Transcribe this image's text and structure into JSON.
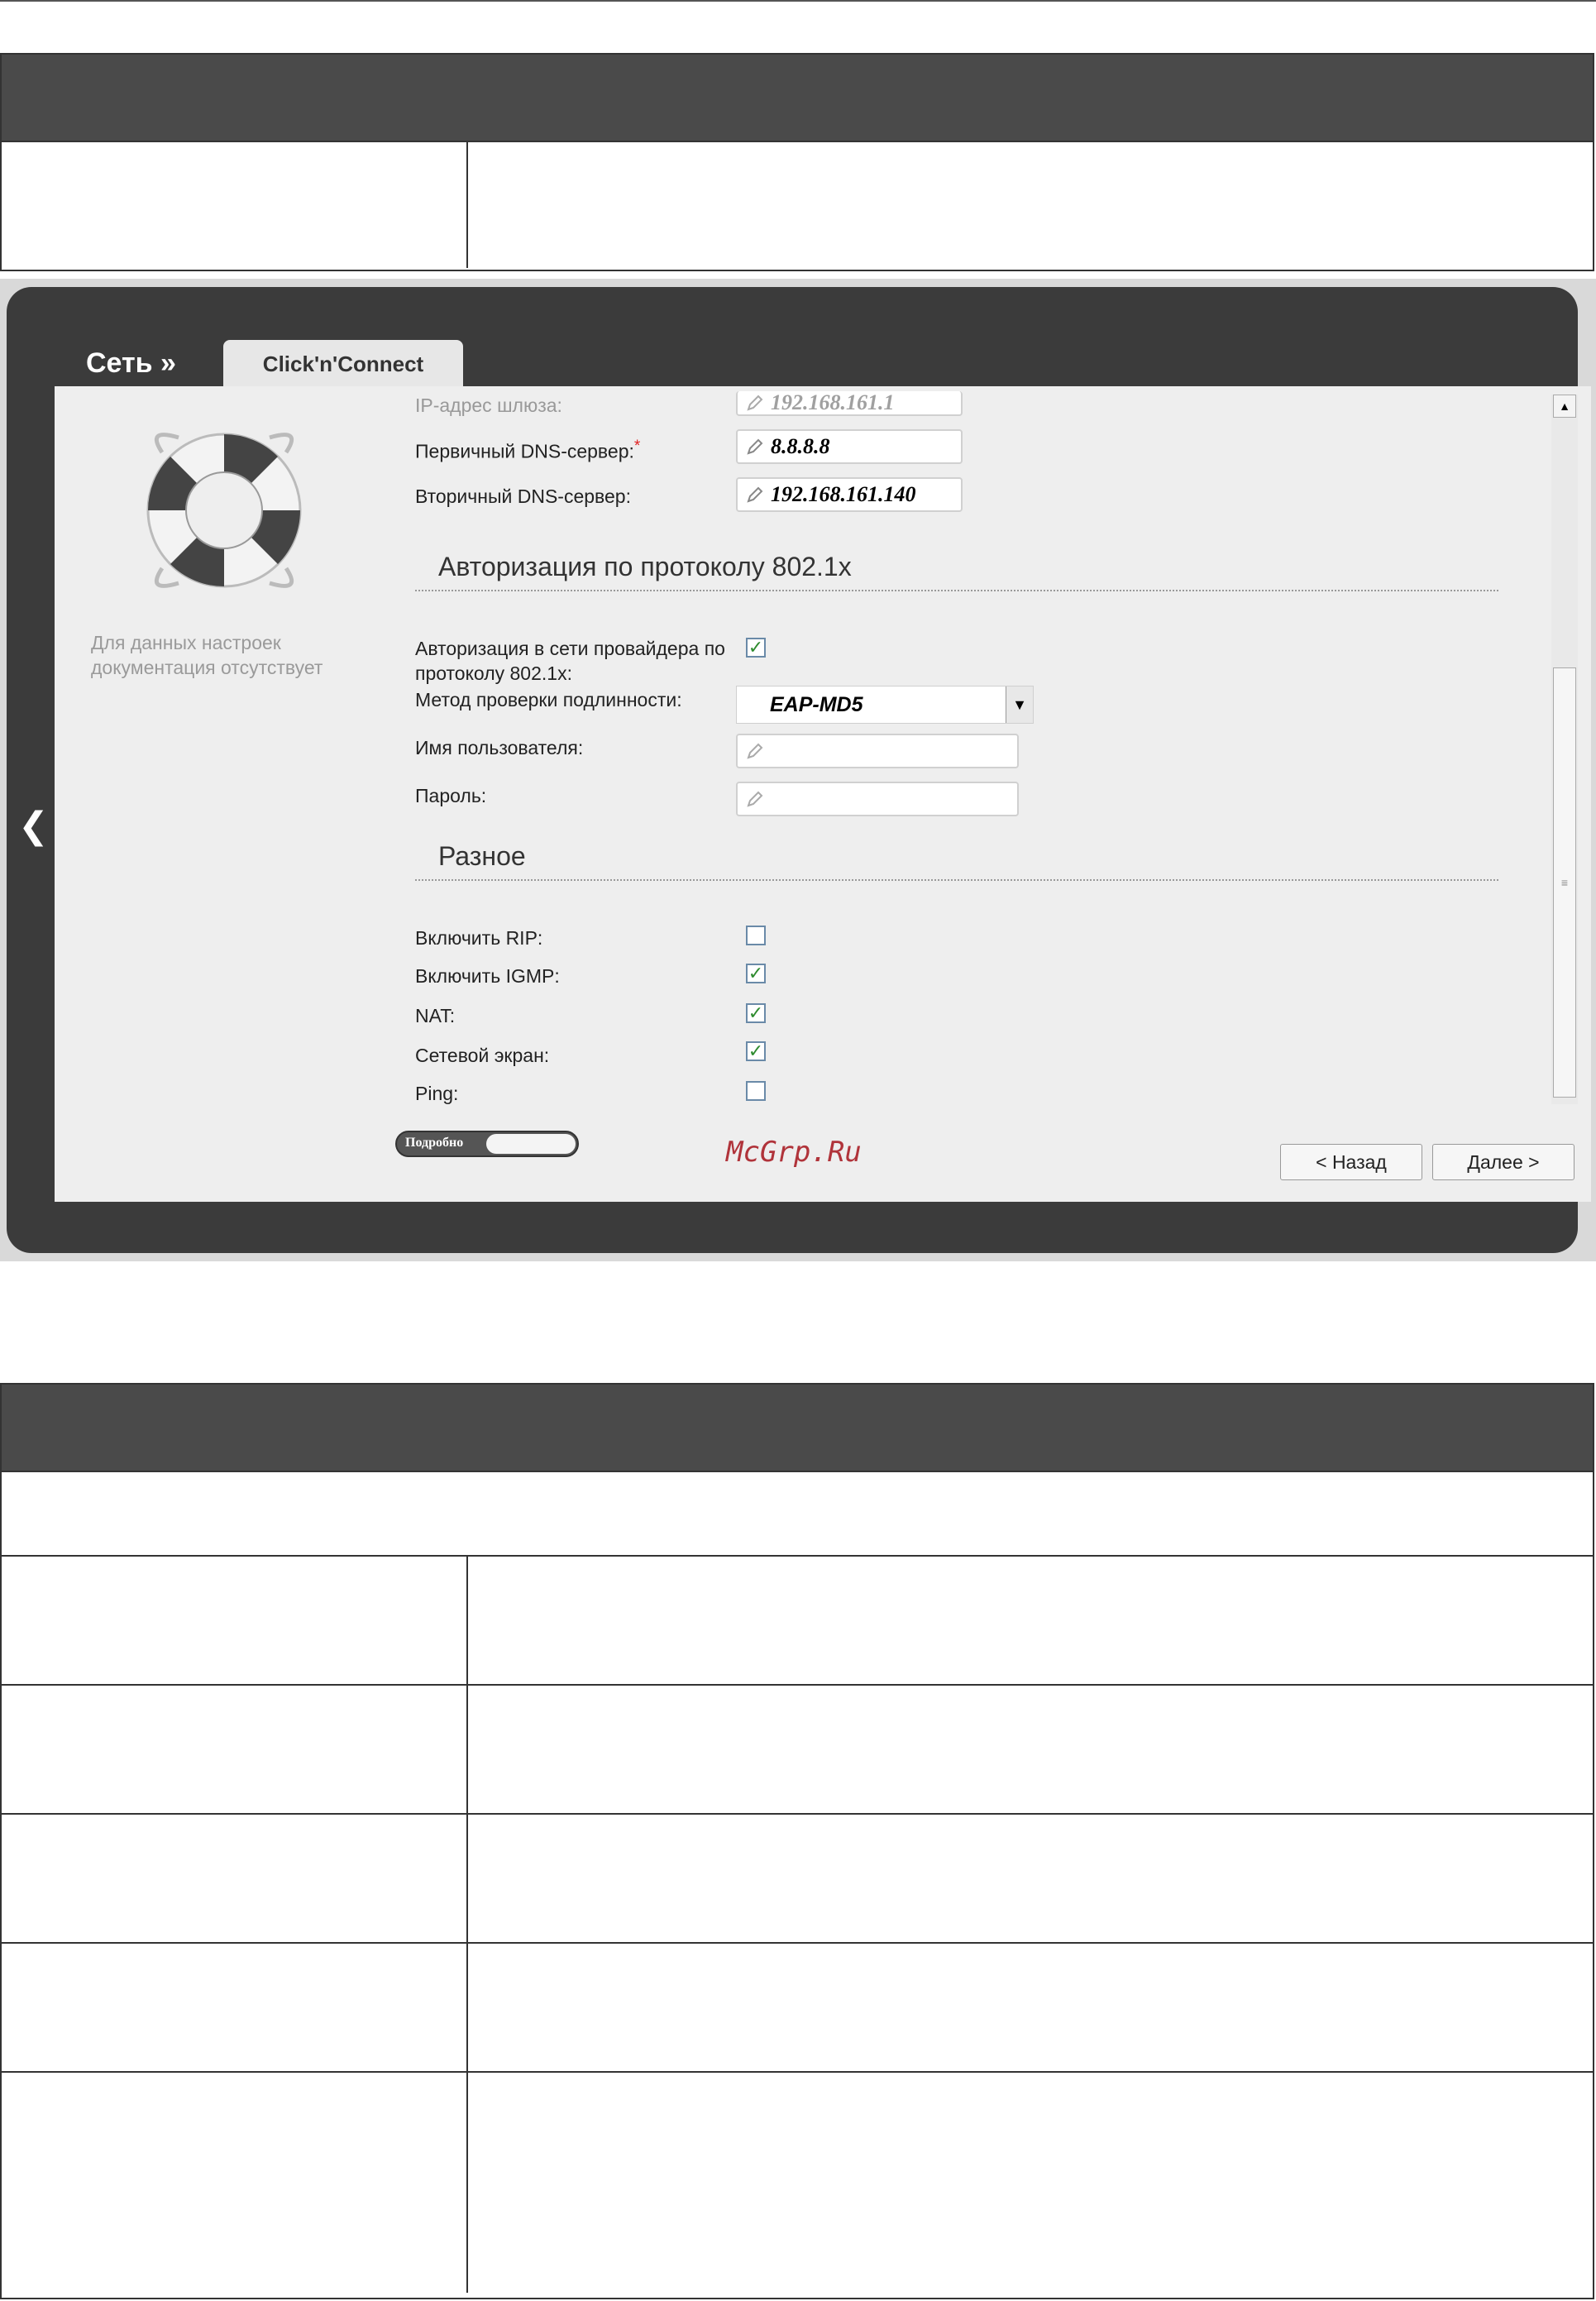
{
  "router": {
    "breadcrumb": "Сеть »",
    "tab": "Click'n'Connect",
    "no_docs": "Для данных настроек документация отсутствует",
    "fields": {
      "gateway": {
        "label": "IP-адрес шлюза:",
        "value": "192.168.161.1"
      },
      "dns1": {
        "label": "Первичный DNS-сервер:",
        "required_mark": "*",
        "value": "8.8.8.8"
      },
      "dns2": {
        "label": "Вторичный DNS-сервер:",
        "value": "192.168.161.140"
      }
    },
    "auth": {
      "title": "Авторизация по протоколу 802.1x",
      "enable_label": "Авторизация в сети провайдера по протоколу 802.1x:",
      "enable_checked": true,
      "method_label": "Метод проверки подлинности:",
      "method_value": "EAP-MD5",
      "user_label": "Имя пользователя:",
      "user_value": "",
      "pass_label": "Пароль:",
      "pass_value": ""
    },
    "misc": {
      "title": "Разное",
      "items": [
        {
          "label": "Включить RIP:",
          "checked": false
        },
        {
          "label": "Включить IGMP:",
          "checked": true
        },
        {
          "label": "NAT:",
          "checked": true
        },
        {
          "label": "Сетевой экран:",
          "checked": true
        },
        {
          "label": "Ping:",
          "checked": false
        }
      ]
    },
    "details_toggle": "Подробно",
    "back_button": "< Назад",
    "next_button": "Далее >",
    "watermark": "McGrp.Ru"
  }
}
